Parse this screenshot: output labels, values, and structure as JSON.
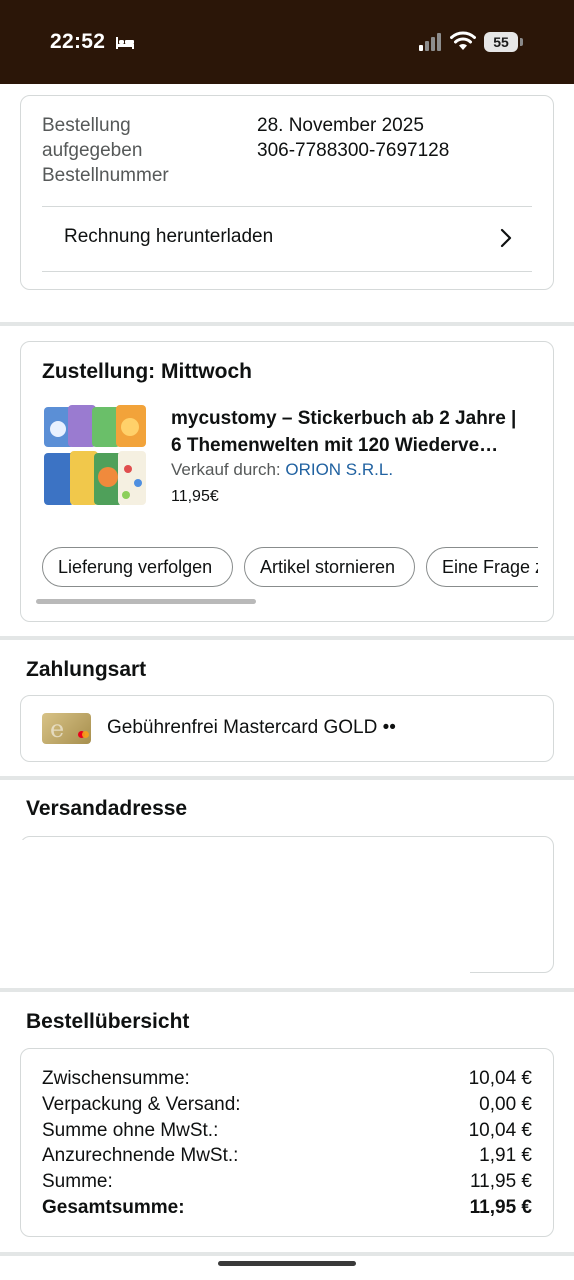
{
  "status_bar": {
    "time": "22:52",
    "battery": "55",
    "icons": [
      "bed-icon",
      "signal-icon",
      "wifi-icon",
      "battery-icon"
    ]
  },
  "order_info": {
    "order_placed_label": "Bestellung aufgegeben",
    "order_placed_label_line1": "Bestellung",
    "order_placed_label_line2": "aufgegeben",
    "order_placed_value": "28. November 2025",
    "order_number_label": "Bestellnummer",
    "order_number_value": "306-7788300-7697128",
    "invoice_link": "Rechnung herunterladen"
  },
  "delivery": {
    "heading": "Zustellung: Mittwoch",
    "product": {
      "title_line1": "mycustomy – Stickerbuch ab 2 Jahre |",
      "title_line2": "6 Themenwelten mit 120 Wiederve…",
      "seller_prefix": "Verkauf durch:",
      "seller_name": "ORION S.R.L.",
      "price": "11,95€"
    },
    "actions": [
      "Lieferung verfolgen",
      "Artikel stornieren",
      "Eine Frage z"
    ]
  },
  "payment": {
    "heading": "Zahlungsart",
    "method": "Gebührenfrei Mastercard GOLD ••"
  },
  "shipping": {
    "heading": "Versandadresse"
  },
  "summary": {
    "heading": "Bestellübersicht",
    "rows": [
      {
        "label": "Zwischensumme:",
        "value": "10,04 €"
      },
      {
        "label": "Verpackung & Versand:",
        "value": "0,00 €"
      },
      {
        "label": "Summe ohne MwSt.:",
        "value": "10,04 €"
      },
      {
        "label": "Anzurechnende MwSt.:",
        "value": "1,91 €"
      },
      {
        "label": "Summe:",
        "value": "11,95 €"
      },
      {
        "label": "Gesamtsumme:",
        "value": "11,95 €"
      }
    ]
  },
  "colors": {
    "status_bar_bg": "#2b1608",
    "link_blue": "#2162a1",
    "border": "#d5d9d9",
    "text": "#0f1111",
    "muted": "#565959"
  }
}
